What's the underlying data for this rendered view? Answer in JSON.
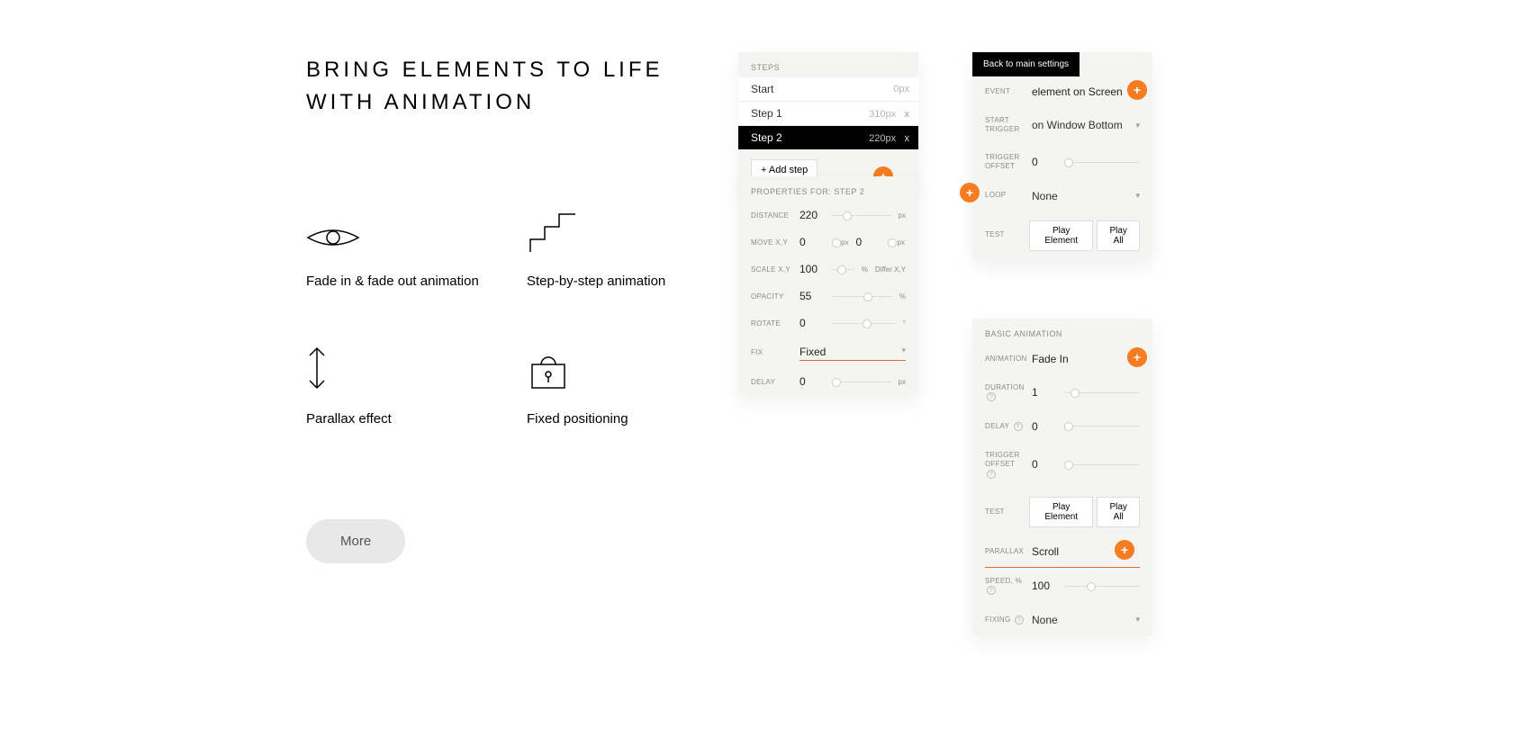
{
  "heading_line1": "BRING ELEMENTS TO LIFE",
  "heading_line2": "WITH ANIMATION",
  "features": [
    {
      "label": "Fade in & fade out animation"
    },
    {
      "label": "Step-by-step animation"
    },
    {
      "label": "Parallax effect"
    },
    {
      "label": "Fixed positioning"
    }
  ],
  "more_button": "More",
  "steps_panel": {
    "title": "STEPS",
    "rows": [
      {
        "name": "Start",
        "px": "0px"
      },
      {
        "name": "Step 1",
        "px": "310px"
      },
      {
        "name": "Step 2",
        "px": "220px"
      }
    ],
    "add_step": "+ Add step"
  },
  "props_panel": {
    "title": "PROPERTIES FOR: STEP 2",
    "distance_label": "DISTANCE",
    "distance_val": "220",
    "px_unit": "px",
    "move_label": "MOVE X,Y",
    "move_x": "0",
    "move_y": "0",
    "scale_label": "SCALE X,Y",
    "scale_val": "100",
    "pct_unit": "%",
    "differ": "Differ X,Y",
    "opacity_label": "OPACITY",
    "opacity_val": "55",
    "rotate_label": "ROTATE",
    "rotate_val": "0",
    "deg_unit": "°",
    "fix_label": "FIX",
    "fix_val": "Fixed",
    "delay_label": "DELAY",
    "delay_val": "0"
  },
  "event_panel": {
    "back": "Back to main settings",
    "event_label": "EVENT",
    "event_val": "element on Screen",
    "start_trigger_label": "START TRIGGER",
    "start_trigger_val": "on Window Bottom",
    "trigger_offset_label": "TRIGGER OFFSET",
    "trigger_offset_val": "0",
    "loop_label": "LOOP",
    "loop_val": "None",
    "test_label": "TEST",
    "play_element": "Play Element",
    "play_all": "Play All"
  },
  "basic_panel": {
    "title": "BASIC ANIMATION",
    "animation_label": "ANIMATION",
    "animation_val": "Fade In",
    "duration_label": "DURATION",
    "duration_val": "1",
    "delay_label": "DELAY",
    "delay_val": "0",
    "trigger_offset_label": "TRIGGER OFFSET",
    "trigger_offset_val": "0",
    "test_label": "TEST",
    "play_element": "Play Element",
    "play_all": "Play All",
    "parallax_label": "PARALLAX",
    "parallax_val": "Scroll",
    "speed_label": "SPEED, %",
    "speed_val": "100",
    "fixing_label": "FIXING",
    "fixing_val": "None"
  }
}
